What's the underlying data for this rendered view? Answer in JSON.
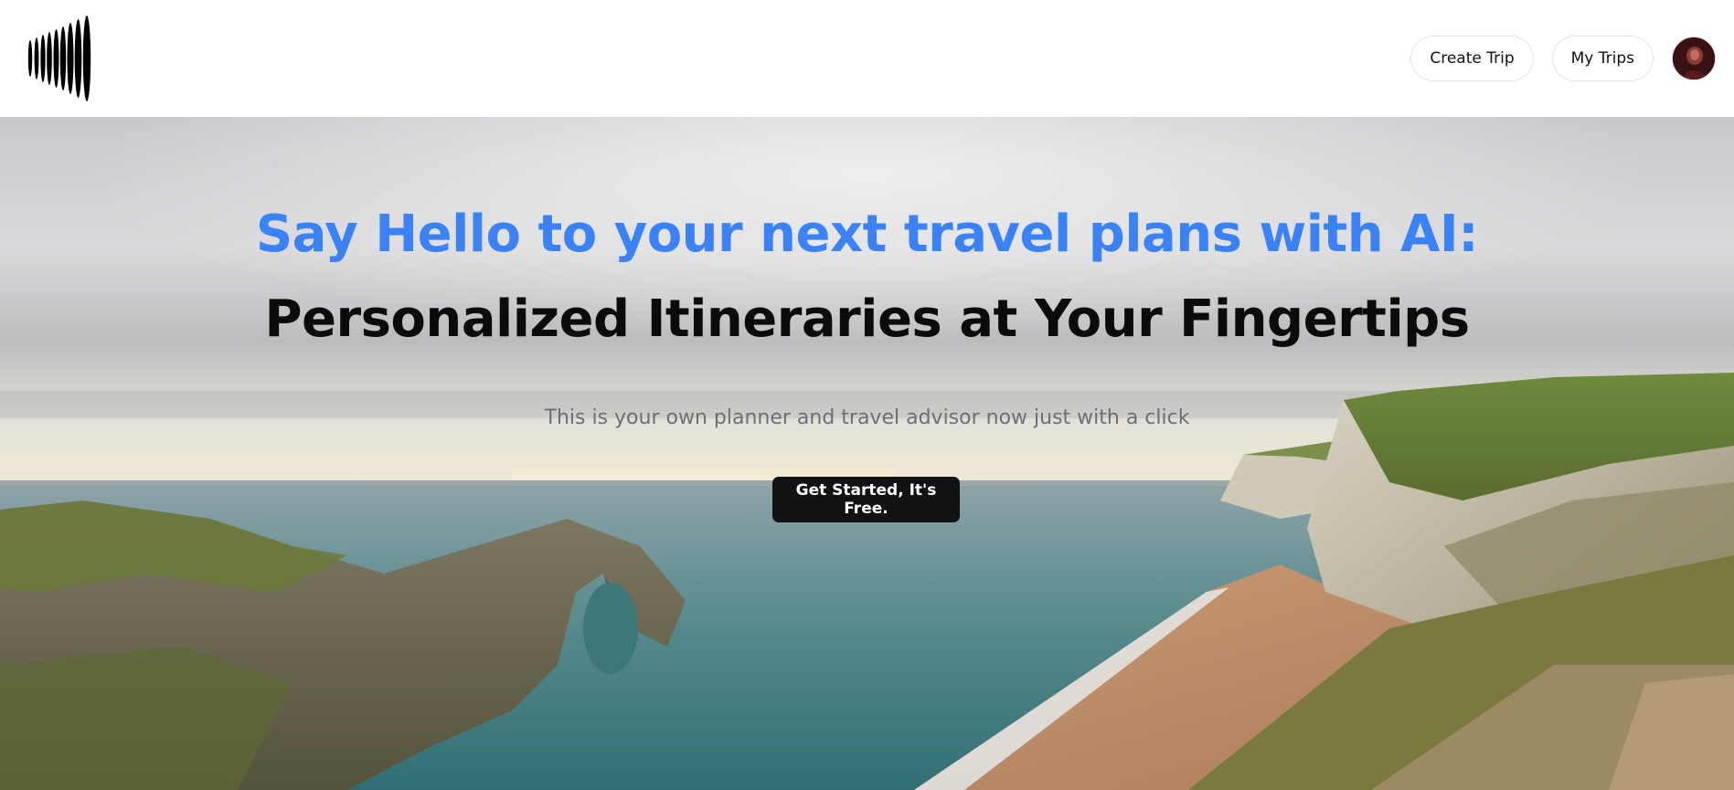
{
  "header": {
    "create_trip_label": "Create Trip",
    "my_trips_label": "My Trips",
    "logo_icon": "vertical-bars-logo-icon",
    "avatar_icon": "user-avatar"
  },
  "hero": {
    "headline_line1": "Say Hello to your next travel plans with AI:",
    "headline_line2": "Personalized Itineraries at Your Fingertips",
    "subtitle": "This is your own planner and travel advisor now just with a click",
    "cta_label": "Get Started, It's Free.",
    "background_image": "coastal-cliffs-sea-arch-landscape"
  },
  "colors": {
    "accent_blue": "#3b82f6",
    "headline_dark": "#0b0b0b",
    "cta_bg": "#111214",
    "subtitle_gray": "#6b6f76"
  }
}
